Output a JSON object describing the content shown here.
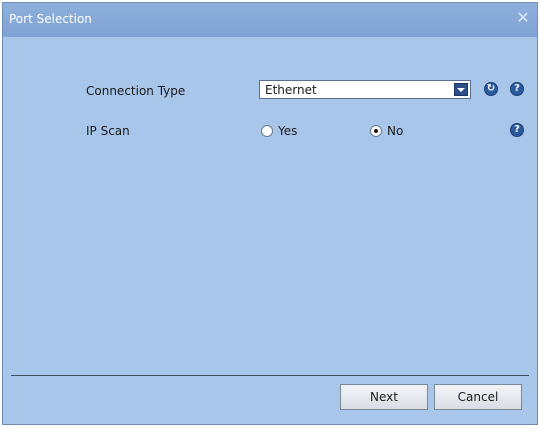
{
  "window": {
    "title": "Port Selection",
    "close_icon": "close-icon"
  },
  "connection": {
    "label": "Connection Type",
    "selected": "Ethernet",
    "refresh_icon": "refresh-icon",
    "help_icon": "help-icon"
  },
  "ip_scan": {
    "label": "IP Scan",
    "options": [
      {
        "label": "Yes",
        "checked": false
      },
      {
        "label": "No",
        "checked": true
      }
    ],
    "help_icon": "help-icon"
  },
  "footer": {
    "next_label": "Next",
    "cancel_label": "Cancel"
  },
  "colors": {
    "background": "#a8c6ea",
    "titlebar": "#7ea2d3",
    "icon": "#2a5aa0"
  }
}
